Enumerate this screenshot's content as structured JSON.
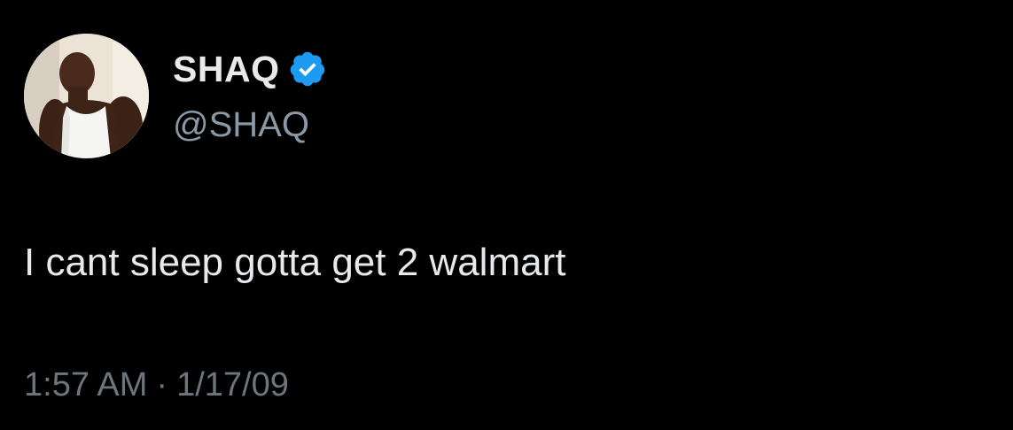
{
  "tweet": {
    "author": {
      "display_name": "SHAQ",
      "handle": "@SHAQ",
      "verified": true,
      "avatar_icon": "profile-photo",
      "verified_icon": "verified-badge-icon",
      "verified_color": "#1d9bf0"
    },
    "text": "I cant sleep gotta get 2 walmart",
    "time": "1:57 AM",
    "separator": "·",
    "date": "1/17/09"
  },
  "theme": {
    "background": "#000000",
    "primary_text": "#e7e9ea",
    "secondary_text": "#6e767d"
  }
}
